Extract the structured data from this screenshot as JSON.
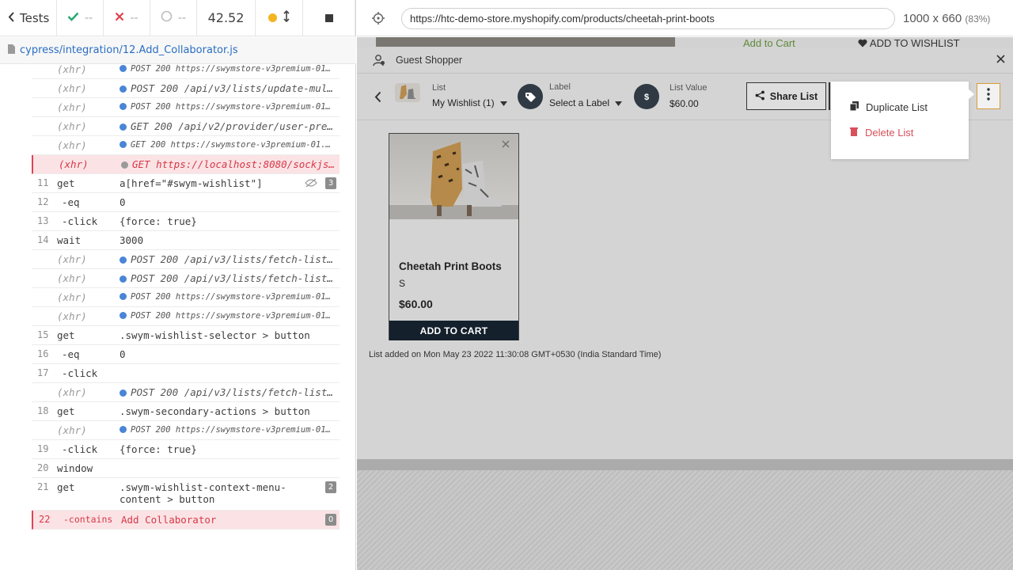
{
  "reporter": {
    "tests_label": "Tests",
    "passed": "--",
    "failed": "--",
    "pending": "--",
    "duration": "42.52",
    "spec_file": "cypress/integration/12.Add_Collaborator.js"
  },
  "log": [
    {
      "type": "xhr",
      "num": "",
      "cmd": "(xhr)",
      "msg": "POST 200 https://swymstore-v3premium-01...",
      "small": true,
      "bul": "blue"
    },
    {
      "type": "xhr",
      "num": "",
      "cmd": "(xhr)",
      "msg": "POST 200 /api/v3/lists/update-mul...",
      "small": false,
      "bul": "blue"
    },
    {
      "type": "xhr",
      "num": "",
      "cmd": "(xhr)",
      "msg": "POST 200 https://swymstore-v3premium-01...",
      "small": true,
      "bul": "blue"
    },
    {
      "type": "xhr",
      "num": "",
      "cmd": "(xhr)",
      "msg": "GET 200 /api/v2/provider/user-pre...",
      "small": false,
      "bul": "blue"
    },
    {
      "type": "xhr",
      "num": "",
      "cmd": "(xhr)",
      "msg": "GET 200 https://swymstore-v3premium-01.s...",
      "small": true,
      "bul": "blue"
    },
    {
      "type": "err-xhr",
      "num": "",
      "cmd": "(xhr)",
      "msg": "GET https://localhost:8080/sockjs...",
      "small": false,
      "bul": "grey"
    },
    {
      "type": "cmd",
      "num": "11",
      "cmd": "get",
      "msg": "a[href=\"#swym-wishlist\"]",
      "badge": "3",
      "eye": true
    },
    {
      "type": "cmd",
      "num": "12",
      "cmd": "-eq",
      "msg": "0",
      "child": true
    },
    {
      "type": "cmd",
      "num": "13",
      "cmd": "-click",
      "msg": "{force: true}",
      "child": true
    },
    {
      "type": "cmd",
      "num": "14",
      "cmd": "wait",
      "msg": "3000"
    },
    {
      "type": "xhr",
      "num": "",
      "cmd": "(xhr)",
      "msg": "POST 200 /api/v3/lists/fetch-list...",
      "small": false,
      "bul": "blue"
    },
    {
      "type": "xhr",
      "num": "",
      "cmd": "(xhr)",
      "msg": "POST 200 /api/v3/lists/fetch-list...",
      "small": false,
      "bul": "blue"
    },
    {
      "type": "xhr",
      "num": "",
      "cmd": "(xhr)",
      "msg": "POST 200 https://swymstore-v3premium-01...",
      "small": true,
      "bul": "blue"
    },
    {
      "type": "xhr",
      "num": "",
      "cmd": "(xhr)",
      "msg": "POST 200 https://swymstore-v3premium-01...",
      "small": true,
      "bul": "blue"
    },
    {
      "type": "cmd",
      "num": "15",
      "cmd": "get",
      "msg": ".swym-wishlist-selector > button"
    },
    {
      "type": "cmd",
      "num": "16",
      "cmd": "-eq",
      "msg": "0",
      "child": true
    },
    {
      "type": "cmd",
      "num": "17",
      "cmd": "-click",
      "msg": "",
      "child": true
    },
    {
      "type": "xhr",
      "num": "",
      "cmd": "(xhr)",
      "msg": "POST 200 /api/v3/lists/fetch-list...",
      "small": false,
      "bul": "blue"
    },
    {
      "type": "cmd",
      "num": "18",
      "cmd": "get",
      "msg": ".swym-secondary-actions > button"
    },
    {
      "type": "xhr",
      "num": "",
      "cmd": "(xhr)",
      "msg": "POST 200 https://swymstore-v3premium-01...",
      "small": true,
      "bul": "blue"
    },
    {
      "type": "cmd",
      "num": "19",
      "cmd": "-click",
      "msg": "{force: true}",
      "child": true
    },
    {
      "type": "cmd",
      "num": "20",
      "cmd": "window",
      "msg": ""
    },
    {
      "type": "cmd",
      "num": "21",
      "cmd": "get",
      "msg": ".swym-wishlist-context-menu-content > button",
      "badge": "2",
      "wrap": true
    },
    {
      "type": "err",
      "num": "22",
      "cmd": "-contains",
      "msg": "Add Collaborator",
      "badge": "0",
      "child": true
    }
  ],
  "browser": {
    "url": "https://htc-demo-store.myshopify.com/products/cheetah-print-boots",
    "viewport": "1000 x 660",
    "scale": "(83%)"
  },
  "page_bg": {
    "add_to_cart": "Add to Cart",
    "add_to_wishlist": "ADD TO WISHLIST"
  },
  "modal": {
    "guest": "Guest Shopper",
    "list_label": "List",
    "list_value": "My Wishlist (1)",
    "label_label": "Label",
    "label_value": "Select a Label",
    "list_value_label": "List Value",
    "list_value_amount": "$60.00",
    "share": "Share List",
    "menu": {
      "duplicate": "Duplicate List",
      "delete": "Delete List"
    },
    "product": {
      "title": "Cheetah Print Boots",
      "variant": "S",
      "price": "$60.00",
      "atc": "ADD TO CART"
    },
    "added_on": "List added on Mon May 23 2022 11:30:08 GMT+0530 (India Standard Time)"
  },
  "colors": {
    "pass": "#1fa971",
    "fail": "#e0404c",
    "xhr_dot": "#4a85d6",
    "accent_menu": "#d79b3a",
    "delete": "#d8505a",
    "atc_bg": "#14202c"
  }
}
